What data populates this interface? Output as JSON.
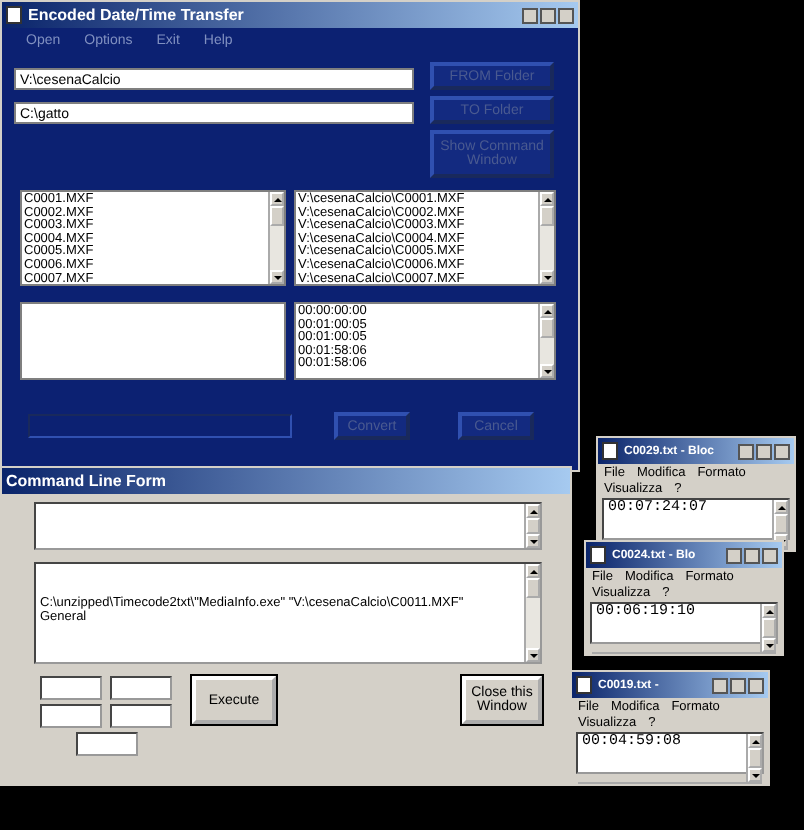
{
  "main_window": {
    "title": "Encoded Date/Time Transfer",
    "menu": [
      "Open",
      "Options",
      "Exit",
      "Help"
    ],
    "source_path": "V:\\cesenaCalcio",
    "destination_path": "C:\\gatto",
    "buttons": {
      "from_folder": "FROM Folder",
      "to_folder": "TO Folder",
      "show_command": "Show Command Window",
      "convert": "Convert",
      "cancel": "Cancel"
    },
    "file_list": [
      "C0001.MXF",
      "C0002.MXF",
      "C0003.MXF",
      "C0004.MXF",
      "C0005.MXF",
      "C0006.MXF",
      "C0007.MXF"
    ],
    "path_list": [
      "V:\\cesenaCalcio\\C0001.MXF",
      "V:\\cesenaCalcio\\C0002.MXF",
      "V:\\cesenaCalcio\\C0003.MXF",
      "V:\\cesenaCalcio\\C0004.MXF",
      "V:\\cesenaCalcio\\C0005.MXF",
      "V:\\cesenaCalcio\\C0006.MXF",
      "V:\\cesenaCalcio\\C0007.MXF"
    ],
    "time_list": [
      "00:00:00:00",
      "00:01:00:05",
      "00:01:00:05",
      "00:01:58:06",
      "00:01:58:06"
    ]
  },
  "command_window": {
    "title": "Command Line Form",
    "output_lines": [
      "C:\\unzipped\\Timecode2txt\\\"MediaInfo.exe\" \"V:\\cesenaCalcio\\C0011.MXF\"",
      "General"
    ],
    "execute": "Execute",
    "close": "Close this Window"
  },
  "notepads": [
    {
      "title": "C0029.txt - Bloc",
      "menu": [
        "File",
        "Modifica",
        "Formato",
        "Visualizza",
        "?"
      ],
      "text": "00:07:24:07"
    },
    {
      "title": "C0024.txt - Blo",
      "menu": [
        "File",
        "Modifica",
        "Formato",
        "Visualizza",
        "?"
      ],
      "text": "00:06:19:10"
    },
    {
      "title": "C0019.txt -",
      "menu": [
        "File",
        "Modifica",
        "Formato",
        "Visualizza",
        "?"
      ],
      "text": "00:04:59:08"
    }
  ]
}
